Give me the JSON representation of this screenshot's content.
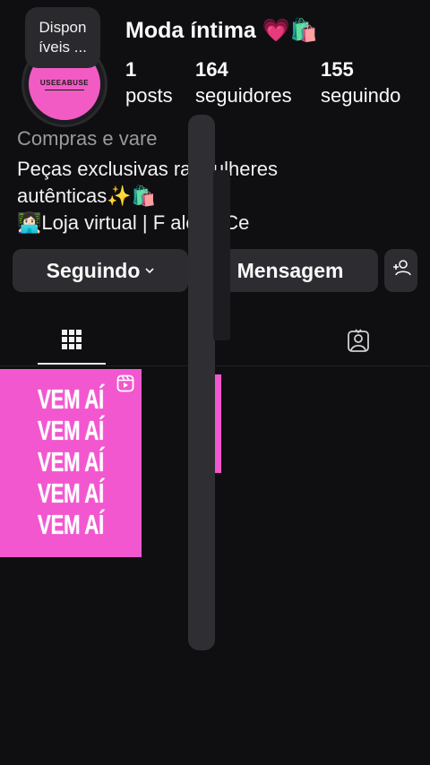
{
  "profile": {
    "name": "Moda íntima 💗🛍️",
    "avatar_text": "USEEABUSE",
    "note": "Dispon íveis ..."
  },
  "stats": [
    {
      "value": "1",
      "label": "posts"
    },
    {
      "value": "164",
      "label": "seguidores"
    },
    {
      "value": "155",
      "label": "seguindo"
    }
  ],
  "category": "Compras e vare",
  "bio": {
    "line1": "Peças exclusivas   ra mulheres",
    "line2": "autênticas✨🛍️",
    "line3": "👩🏻‍💻Loja virtual | F     aleza-Ce"
  },
  "actions": {
    "follow_label": "Seguindo",
    "message_label": "Mensagem"
  },
  "icons": {
    "grid": "grid-icon",
    "tagged": "tagged-person-icon",
    "add_person": "add-person-icon",
    "reel": "reel-icon",
    "chevron": "chevron-down-icon"
  },
  "post": {
    "lines": [
      "VEM AÍ",
      "VEM AÍ",
      "VEM AÍ",
      "VEM AÍ",
      "VEM AÍ"
    ]
  },
  "colors": {
    "background": "#0f0f12",
    "button": "#2d2d31",
    "accent_pink": "#f257cf",
    "muted_text": "#9a9a9e"
  }
}
